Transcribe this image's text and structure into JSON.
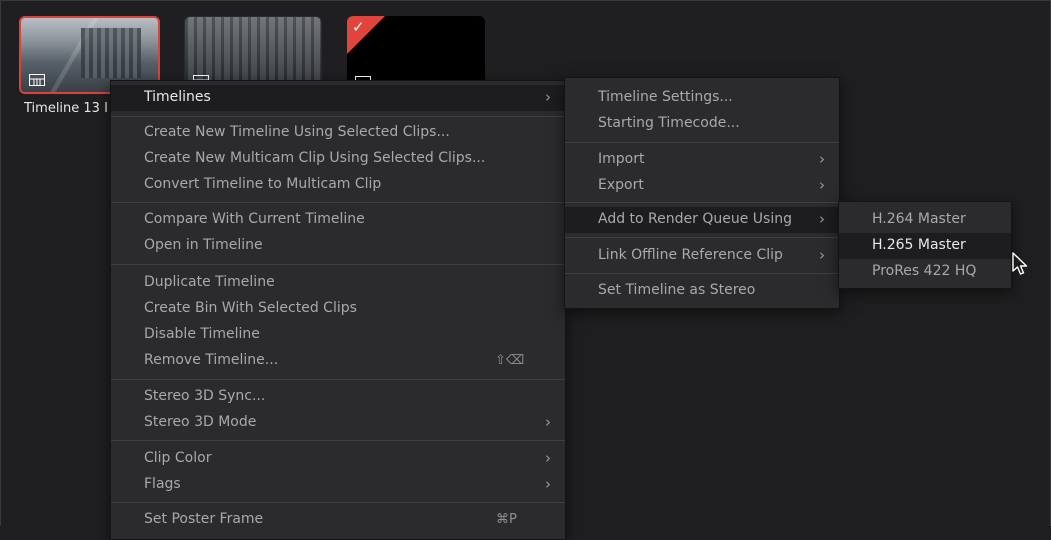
{
  "clips": [
    {
      "label": "Timeline 13 I"
    }
  ],
  "main_menu": {
    "timelines": "Timelines",
    "create_new_timeline": "Create New Timeline Using Selected Clips...",
    "create_new_multicam": "Create New Multicam Clip Using Selected Clips...",
    "convert_to_multicam": "Convert Timeline to Multicam Clip",
    "compare": "Compare With Current Timeline",
    "open_in_timeline": "Open in Timeline",
    "duplicate": "Duplicate Timeline",
    "create_bin": "Create Bin With Selected Clips",
    "disable": "Disable Timeline",
    "remove": "Remove Timeline...",
    "remove_shortcut": "⇧⌫",
    "stereo_sync": "Stereo 3D Sync...",
    "stereo_mode": "Stereo 3D Mode",
    "clip_color": "Clip Color",
    "flags": "Flags",
    "set_poster_frame": "Set Poster Frame",
    "poster_shortcut": "⌘P"
  },
  "timelines_submenu": {
    "settings": "Timeline Settings...",
    "starting_timecode": "Starting Timecode...",
    "import": "Import",
    "export": "Export",
    "add_render_queue": "Add to Render Queue Using",
    "link_offline": "Link Offline Reference Clip",
    "set_stereo": "Set Timeline as Stereo"
  },
  "render_submenu": {
    "items": [
      "H.264 Master",
      "H.265 Master",
      "ProRes 422 HQ"
    ]
  },
  "icons": {
    "submenu_arrow": "chevron-right-icon",
    "timeline": "timeline-icon",
    "cursor": "mouse-pointer-icon"
  },
  "colors": {
    "accent_red": "#d8443c",
    "menu_bg": "#2b2b2e",
    "highlight_bg": "#1d1d1f"
  }
}
